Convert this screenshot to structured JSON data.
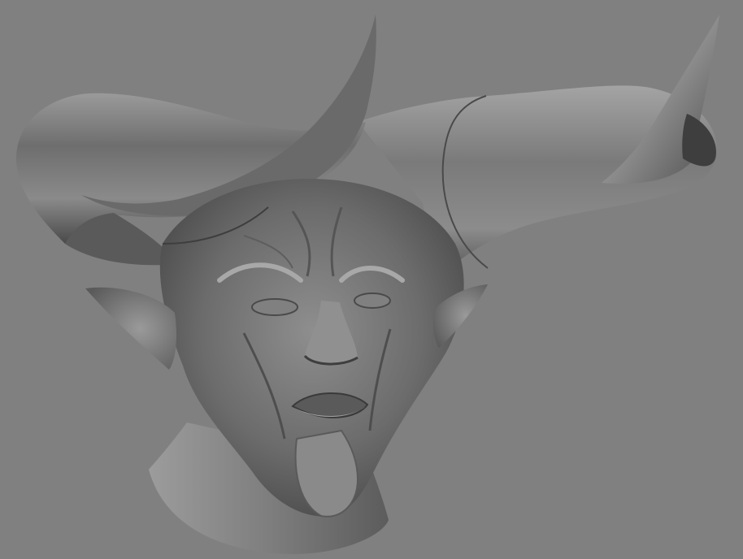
{
  "viewport": {
    "background": "#808080",
    "model_color": "#7a7a7a",
    "highlight_color": "#b4b4b4",
    "shadow_color": "#3c3c3c",
    "subject": "horned-demon-head-sculpt"
  }
}
